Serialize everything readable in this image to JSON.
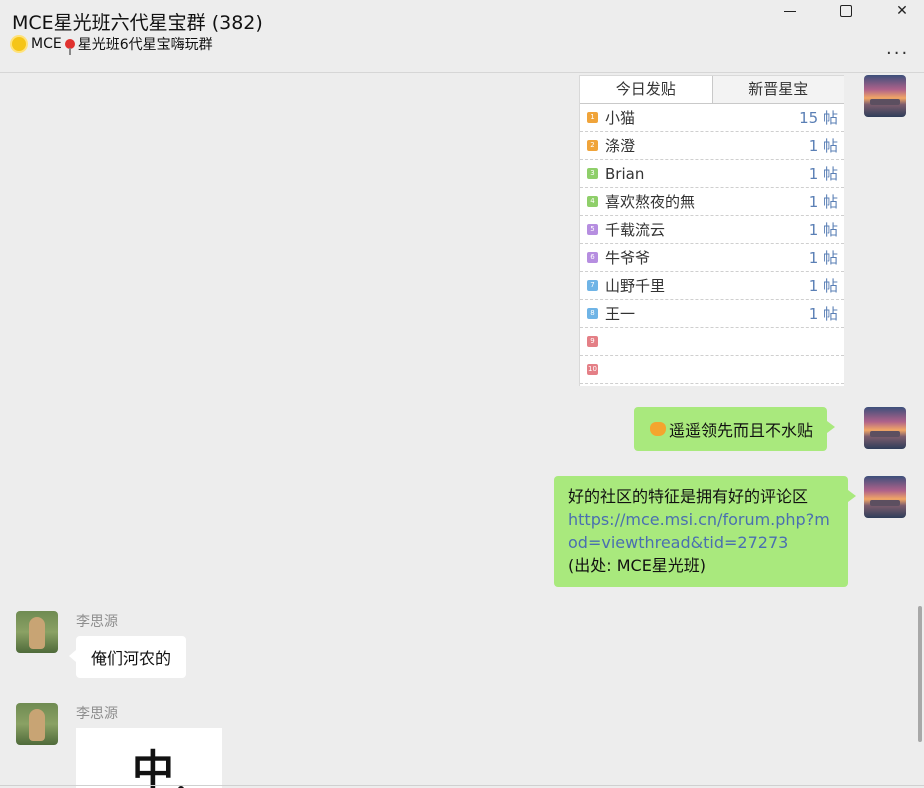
{
  "header": {
    "title": "MCE星光班六代星宝群 (382)",
    "subtitle_prefix": "MCE",
    "subtitle_suffix": "星光班6代星宝嗨玩群",
    "more_label": "..."
  },
  "window_controls": {
    "close_glyph": "✕"
  },
  "rank_card": {
    "tabs": [
      "今日发贴",
      "新晋星宝"
    ],
    "rows": [
      {
        "rank": "1",
        "name": "小猫",
        "count": "15 帖",
        "color": "#f0a43a"
      },
      {
        "rank": "2",
        "name": "涤澄",
        "count": "1 帖",
        "color": "#f0a43a"
      },
      {
        "rank": "3",
        "name": "Brian",
        "count": "1 帖",
        "color": "#8fcf6a"
      },
      {
        "rank": "4",
        "name": "喜欢熬夜的無",
        "count": "1 帖",
        "color": "#8fcf6a"
      },
      {
        "rank": "5",
        "name": "千载流云",
        "count": "1 帖",
        "color": "#b68ee0"
      },
      {
        "rank": "6",
        "name": "牛爷爷",
        "count": "1 帖",
        "color": "#b68ee0"
      },
      {
        "rank": "7",
        "name": "山野千里",
        "count": "1 帖",
        "color": "#6fb4e6"
      },
      {
        "rank": "8",
        "name": "王一",
        "count": "1 帖",
        "color": "#6fb4e6"
      },
      {
        "rank": "9",
        "name": "",
        "count": "",
        "color": "#e47f86"
      },
      {
        "rank": "10",
        "name": "",
        "count": "",
        "color": "#e47f86"
      }
    ]
  },
  "messages": {
    "m1": {
      "text": "遥遥领先而且不水贴"
    },
    "m2": {
      "line1": "好的社区的特征是拥有好的评论区",
      "link": "https://mce.msi.cn/forum.php?mod=viewthread&tid=27273",
      "source": "(出处: MCE星光班)"
    },
    "m3": {
      "sender": "李思源",
      "text": "俺们河农的"
    },
    "m4": {
      "sender": "李思源",
      "image_char": "中"
    }
  },
  "colors": {
    "bubble_self": "#a9e97d",
    "bubble_other": "#ffffff",
    "link": "#4a6fb0"
  }
}
